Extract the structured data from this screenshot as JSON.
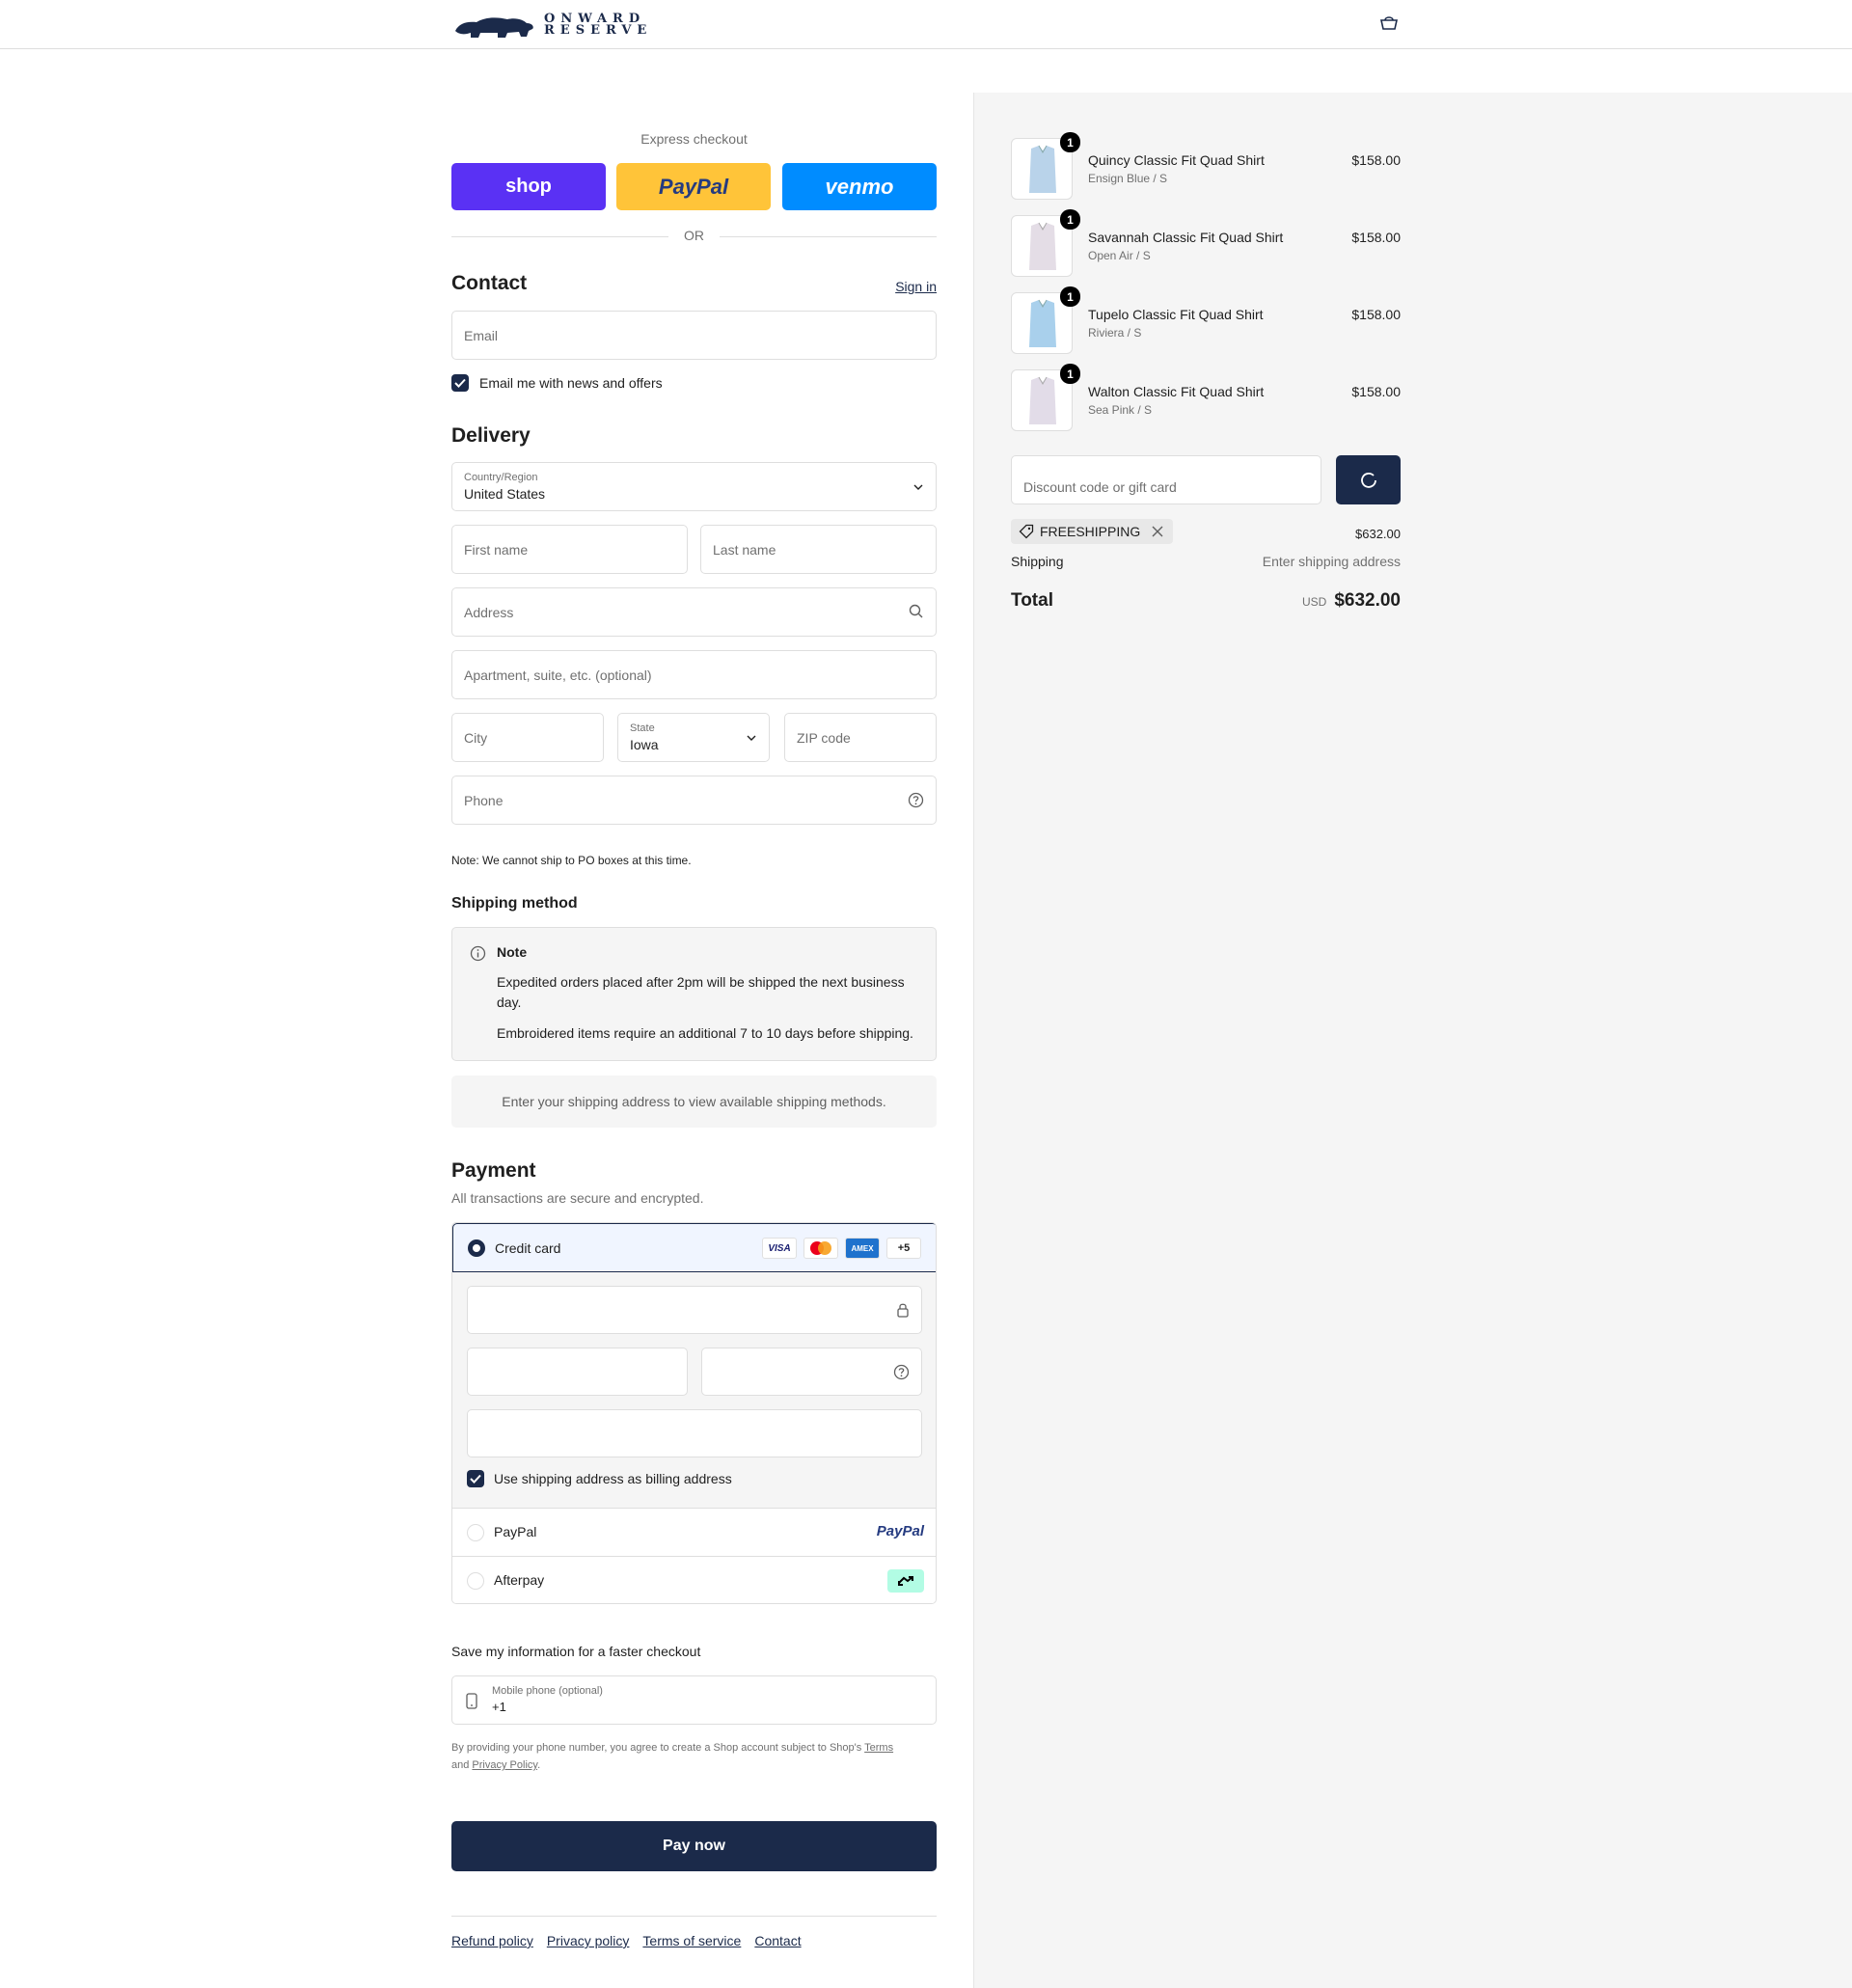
{
  "header": {
    "logo_line1": "ONWARD",
    "logo_line2": "RESERVE"
  },
  "express": {
    "label": "Express checkout",
    "shop": "shop",
    "paypal": "PayPal",
    "venmo": "venmo",
    "or": "OR"
  },
  "contact": {
    "title": "Contact",
    "sign_in": "Sign in",
    "email_placeholder": "Email",
    "newsletter": "Email me with news and offers"
  },
  "delivery": {
    "title": "Delivery",
    "country_label": "Country/Region",
    "country_value": "United States",
    "first_name": "First name",
    "last_name": "Last name",
    "address": "Address",
    "apartment": "Apartment, suite, etc. (optional)",
    "city": "City",
    "state_label": "State",
    "state_value": "Iowa",
    "zip": "ZIP code",
    "phone": "Phone",
    "po_note": "Note: We cannot ship to PO boxes at this time."
  },
  "shipping": {
    "title": "Shipping method",
    "note_title": "Note",
    "note_line1": "Expedited orders placed after 2pm will be shipped the next business day.",
    "note_line2": "Embroidered items require an additional 7 to 10 days before shipping.",
    "placeholder": "Enter your shipping address to view available shipping methods."
  },
  "payment": {
    "title": "Payment",
    "subtitle": "All transactions are secure and encrypted.",
    "credit_card": "Credit card",
    "card_visa": "VISA",
    "card_amex": "AMEX",
    "card_more": "+5",
    "billing_same": "Use shipping address as billing address",
    "paypal": "PayPal",
    "paypal_logo": "PayPal",
    "afterpay": "Afterpay"
  },
  "save": {
    "title": "Save my information for a faster checkout",
    "mobile_label": "Mobile phone (optional)",
    "mobile_value": "+1",
    "legal_1": "By providing your phone number, you agree to create a Shop account subject to Shop's ",
    "legal_terms": "Terms",
    "legal_and": "and ",
    "legal_privacy": "Privacy Policy",
    "legal_end": "."
  },
  "pay_now": "Pay now",
  "footer": {
    "refund": "Refund policy",
    "privacy": "Privacy policy",
    "terms": "Terms of service",
    "contact": "Contact"
  },
  "order": {
    "items": [
      {
        "name": "Quincy Classic Fit Quad Shirt",
        "variant": "Ensign Blue / S",
        "price": "$158.00",
        "qty": "1",
        "color": "#b9d3ea"
      },
      {
        "name": "Savannah Classic Fit Quad Shirt",
        "variant": "Open Air / S",
        "price": "$158.00",
        "qty": "1",
        "color": "#e4dde6"
      },
      {
        "name": "Tupelo Classic Fit Quad Shirt",
        "variant": "Riviera / S",
        "price": "$158.00",
        "qty": "1",
        "color": "#a9d0ec"
      },
      {
        "name": "Walton Classic Fit Quad Shirt",
        "variant": "Sea Pink / S",
        "price": "$158.00",
        "qty": "1",
        "color": "#e2dce8"
      }
    ],
    "discount_placeholder": "Discount code or gift card",
    "code": "FREESHIPPING",
    "subtotal": "$632.00",
    "shipping_label": "Shipping",
    "shipping_value": "Enter shipping address",
    "total_label": "Total",
    "currency": "USD",
    "total": "$632.00"
  },
  "colors": {
    "brand": "#1b2a4a",
    "shop": "#5a31f4",
    "paypal": "#ffc439",
    "venmo": "#008cff"
  }
}
